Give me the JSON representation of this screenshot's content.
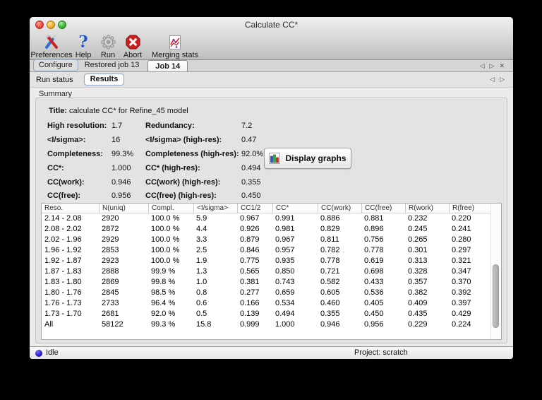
{
  "window": {
    "title": "Calculate CC*"
  },
  "toolbar": {
    "items": [
      {
        "label": "Preferences",
        "icon": "preferences-icon"
      },
      {
        "label": "Help",
        "icon": "help-icon"
      },
      {
        "label": "Run",
        "icon": "run-gear-icon"
      },
      {
        "label": "Abort",
        "icon": "abort-icon"
      },
      {
        "label": "Merging stats",
        "icon": "merging-stats-icon"
      }
    ]
  },
  "tabs": {
    "items": [
      {
        "label": "Configure",
        "active": false
      },
      {
        "label": "Restored job 13",
        "active": false
      },
      {
        "label": "Job 14",
        "active": true
      }
    ],
    "nav": {
      "prev": "◁",
      "next": "▷",
      "close": "✕"
    }
  },
  "subtabs": {
    "items": [
      {
        "label": "Run status",
        "active": false
      },
      {
        "label": "Results",
        "active": true
      }
    ],
    "nav": {
      "prev": "◁",
      "next": "▷"
    }
  },
  "summary": {
    "section_label": "Summary",
    "title_label": "Title:",
    "title_value": "calculate CC* for Refine_45 model",
    "stats": [
      {
        "l1": "High resolution:",
        "v1": "1.7",
        "l2": "Redundancy:",
        "v2": "7.2"
      },
      {
        "l1": "<I/sigma>:",
        "v1": "16",
        "l2": "<I/sigma> (high-res):",
        "v2": "0.47"
      },
      {
        "l1": "Completeness:",
        "v1": "99.3%",
        "l2": "Completeness (high-res):",
        "v2": "92.0%"
      },
      {
        "l1": "CC*:",
        "v1": "1.000",
        "l2": "CC* (high-res):",
        "v2": "0.494"
      },
      {
        "l1": "CC(work):",
        "v1": "0.946",
        "l2": "CC(work) (high-res):",
        "v2": "0.355"
      },
      {
        "l1": "CC(free):",
        "v1": "0.956",
        "l2": "CC(free) (high-res):",
        "v2": "0.450"
      }
    ],
    "display_graphs_label": "Display graphs"
  },
  "table": {
    "columns": [
      "Reso.",
      "N(uniq)",
      "Compl.",
      "<I/sigma>",
      "CC1/2",
      "CC*",
      "CC(work)",
      "CC(free)",
      "R(work)",
      "R(free)"
    ],
    "rows": [
      [
        "2.14 - 2.08",
        "2920",
        "100.0 %",
        "5.9",
        "0.967",
        "0.991",
        "0.886",
        "0.881",
        "0.232",
        "0.220"
      ],
      [
        "2.08 - 2.02",
        "2872",
        "100.0 %",
        "4.4",
        "0.926",
        "0.981",
        "0.829",
        "0.896",
        "0.245",
        "0.241"
      ],
      [
        "2.02 - 1.96",
        "2929",
        "100.0 %",
        "3.3",
        "0.879",
        "0.967",
        "0.811",
        "0.756",
        "0.265",
        "0.280"
      ],
      [
        "1.96 - 1.92",
        "2853",
        "100.0 %",
        "2.5",
        "0.846",
        "0.957",
        "0.782",
        "0.778",
        "0.301",
        "0.297"
      ],
      [
        "1.92 - 1.87",
        "2923",
        "100.0 %",
        "1.9",
        "0.775",
        "0.935",
        "0.778",
        "0.619",
        "0.313",
        "0.321"
      ],
      [
        "1.87 - 1.83",
        "2888",
        "99.9 %",
        "1.3",
        "0.565",
        "0.850",
        "0.721",
        "0.698",
        "0.328",
        "0.347"
      ],
      [
        "1.83 - 1.80",
        "2869",
        "99.8 %",
        "1.0",
        "0.381",
        "0.743",
        "0.582",
        "0.433",
        "0.357",
        "0.370"
      ],
      [
        "1.80 - 1.76",
        "2845",
        "98.5 %",
        "0.8",
        "0.277",
        "0.659",
        "0.605",
        "0.536",
        "0.382",
        "0.392"
      ],
      [
        "1.76 - 1.73",
        "2733",
        "96.4 %",
        "0.6",
        "0.166",
        "0.534",
        "0.460",
        "0.405",
        "0.409",
        "0.397"
      ],
      [
        "1.73 - 1.70",
        "2681",
        "92.0 %",
        "0.5",
        "0.139",
        "0.494",
        "0.355",
        "0.450",
        "0.435",
        "0.429"
      ],
      [
        "All",
        "58122",
        "99.3 %",
        "15.8",
        "0.999",
        "1.000",
        "0.946",
        "0.956",
        "0.229",
        "0.224"
      ]
    ]
  },
  "statusbar": {
    "status_label": "Idle",
    "project_label": "Project: scratch"
  },
  "colors": {
    "status_indicator": "#2d1fd0",
    "traffic_red": "#ee4b40",
    "traffic_yellow": "#f5b02c",
    "traffic_green": "#41b837",
    "abort_red": "#cf1d1d",
    "help_blue": "#2257c4"
  }
}
